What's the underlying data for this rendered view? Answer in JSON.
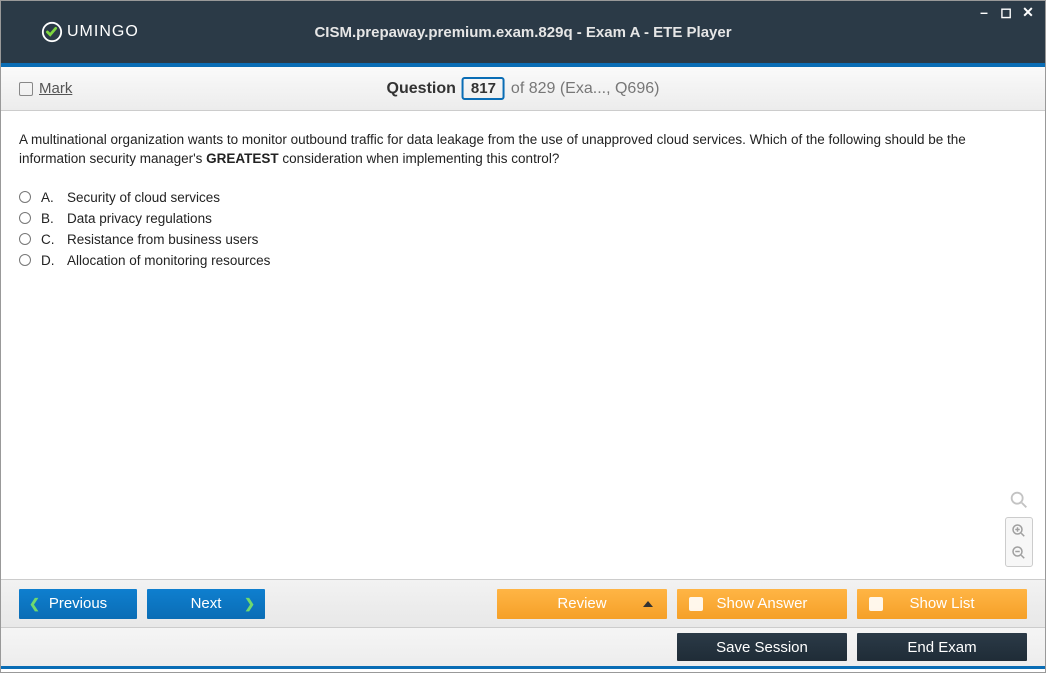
{
  "window": {
    "logo_text": "UMINGO",
    "title": "CISM.prepaway.premium.exam.829q - Exam A - ETE Player"
  },
  "question_bar": {
    "mark_label": "Mark",
    "question_word": "Question",
    "current_number": "817",
    "rest_text": "of 829 (Exa..., Q696)"
  },
  "question": {
    "text_before": "A multinational organization wants to monitor outbound traffic for data leakage from the use of unapproved cloud services. Which of the following should be the information security manager's ",
    "emphasis": "GREATEST",
    "text_after": " consideration when implementing this control?",
    "answers": [
      {
        "letter": "A.",
        "text": "Security of cloud services"
      },
      {
        "letter": "B.",
        "text": "Data privacy regulations"
      },
      {
        "letter": "C.",
        "text": "Resistance from business users"
      },
      {
        "letter": "D.",
        "text": "Allocation of monitoring resources"
      }
    ]
  },
  "nav": {
    "previous": "Previous",
    "next": "Next",
    "review": "Review",
    "show_answer": "Show Answer",
    "show_list": "Show List"
  },
  "session": {
    "save": "Save Session",
    "end": "End Exam"
  }
}
